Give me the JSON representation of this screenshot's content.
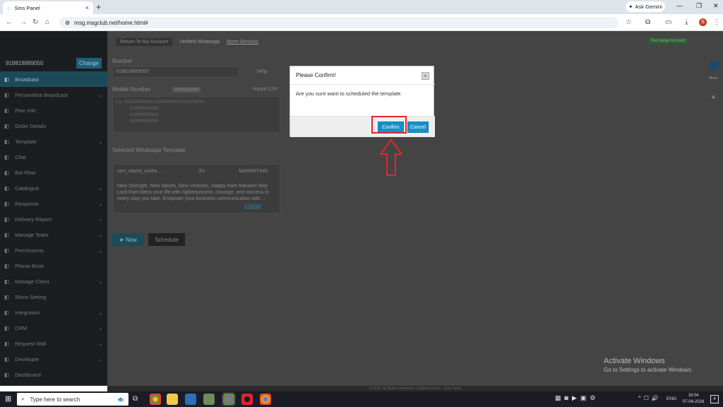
{
  "browser": {
    "tab_title": "Sms Panel",
    "new_tab": "+",
    "url": "msg.msgclub.net/home.html#",
    "ask_gemini": "Ask Gemini",
    "profile_letter": "S"
  },
  "app": {
    "account_number": "918818889050",
    "change_label": "Change",
    "topnav": {
      "return_label": "Return To My Account",
      "verified_whatsapp": "Verified Whatsapp",
      "more_services": "More Services",
      "recharge": "Recharge Account"
    },
    "sidebar": [
      {
        "label": "Broadcast",
        "chev": false
      },
      {
        "label": "Personalize Broadcast",
        "chev": true
      },
      {
        "label": "Plan Info",
        "chev": false
      },
      {
        "label": "Order Details",
        "chev": false
      },
      {
        "label": "Template",
        "chev": true
      },
      {
        "label": "Chat",
        "chev": false
      },
      {
        "label": "Bot Flow",
        "chev": false
      },
      {
        "label": "Catalogue",
        "chev": true
      },
      {
        "label": "Response",
        "chev": true
      },
      {
        "label": "Delivery Report",
        "chev": true
      },
      {
        "label": "Manage Team",
        "chev": true
      },
      {
        "label": "Permissions",
        "chev": true
      },
      {
        "label": "Phone Book",
        "chev": false
      },
      {
        "label": "Manage Client",
        "chev": true
      },
      {
        "label": "Show Setting",
        "chev": false
      },
      {
        "label": "Integration",
        "chev": true
      },
      {
        "label": "CRM",
        "chev": true
      },
      {
        "label": "Request Wall",
        "chev": true
      },
      {
        "label": "Developer",
        "chev": true
      },
      {
        "label": "Dashboard",
        "chev": false
      }
    ],
    "form": {
      "number_label": "Number",
      "number_value": "918818889050",
      "help_label": "Help",
      "mobile_label": "Mobile Number",
      "mobile_tag": "existing groups",
      "import_csv": "Import CSV",
      "mobile_placeholder": "e.g. 919999999999,91999999999,9199999999",
      "mobile_values": [
        "919999999999",
        "919999999999",
        "919999999999"
      ],
      "template_section_label": "Selected Whatsapp Template",
      "template_name": "ram_navmi_wishe...",
      "template_lang": "En",
      "template_category": "MARKETING",
      "template_body": "New Strength, New Values, New Victories. Happy Ram Navami! May Lord Ram bless your life with righteousness, courage, and success in every step you take. Empower your business communication with ...",
      "change_link": "Change",
      "now_label": "Now",
      "schedule_label": "Schedule"
    },
    "right_rail": {
      "menu_label": "Menu",
      "plus": "+"
    },
    "footer": "© 2026. All Rights Reserved. Company Name - Sms Panel"
  },
  "modal": {
    "title": "Please Confirm!",
    "message": "Are you sure want to scheduled the template.",
    "confirm_label": "Confirm",
    "cancel_label": "Cancel",
    "close_label": "×"
  },
  "os": {
    "watermark_title": "Activate Windows",
    "watermark_sub": "Go to Settings to activate Windows.",
    "search_placeholder": "Type here to search",
    "language": "ENG",
    "time": "18:04",
    "date": "07-04-2026",
    "notification_count": "4"
  },
  "colors": {
    "accent": "#1591c9",
    "highlight": "#e0262e"
  }
}
